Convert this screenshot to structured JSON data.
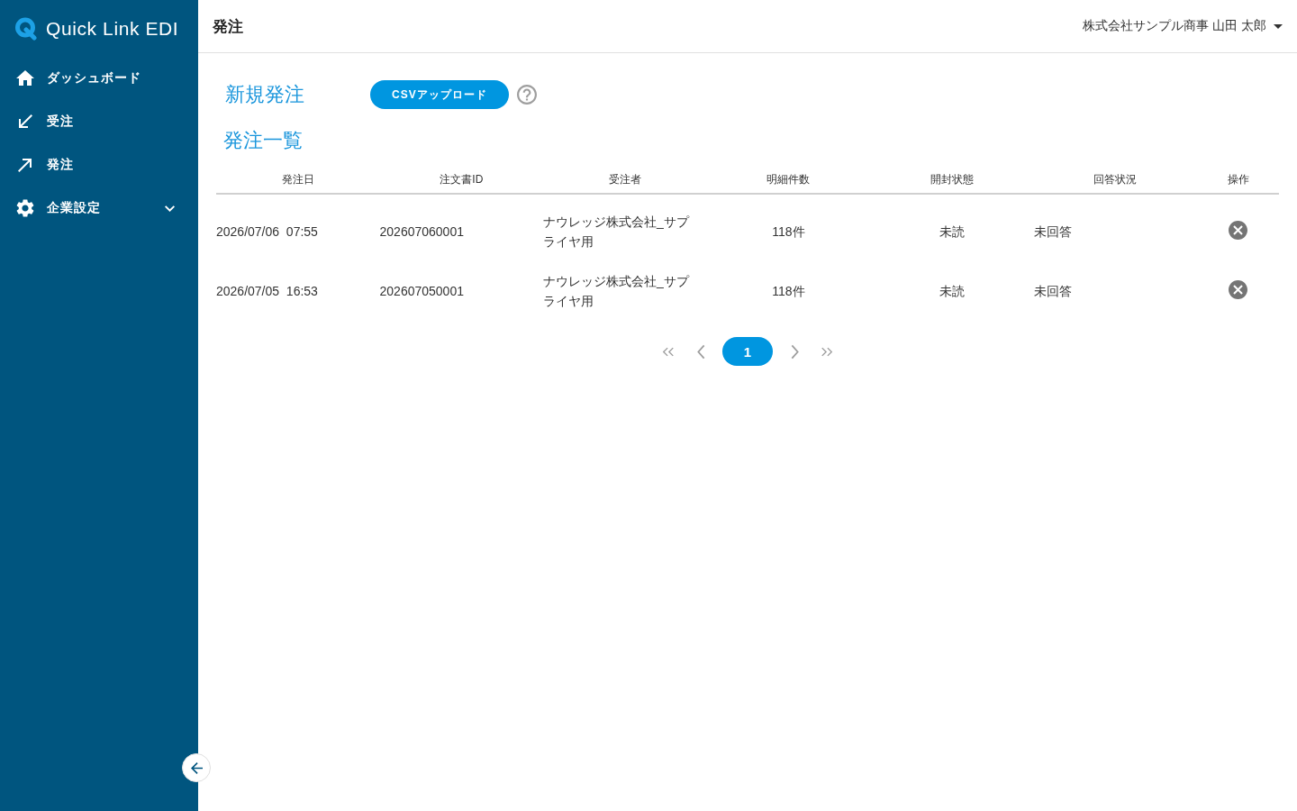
{
  "sidebar": {
    "logo": "Quick Link EDI",
    "items": [
      {
        "kind": "link",
        "label": "ダッシュボード"
      },
      {
        "kind": "link",
        "label": "受注"
      },
      {
        "kind": "link",
        "label": "発注"
      },
      {
        "kind": "group",
        "label": "企業設定",
        "expanded": false
      }
    ]
  },
  "header": {
    "title": "発注",
    "user": "株式会社サンプル商事 山田 太郎"
  },
  "new_order": {
    "heading": "新規発注",
    "upload_button": "CSVアップロード"
  },
  "order_list": {
    "heading": "発注一覧",
    "columns": [
      "発注日",
      "注文書ID",
      "受注者",
      "明細件数",
      "開封状態",
      "回答状況",
      "操作"
    ],
    "rows": [
      {
        "order_date": "2026/07/06  07:55",
        "order_id": "202607060001",
        "recipient": "ナウレッジ株式会社_サプライヤ用",
        "line_count": "118件",
        "open_status": "未読",
        "reply_status": "未回答"
      },
      {
        "order_date": "2026/07/05  16:53",
        "order_id": "202607050001",
        "recipient": "ナウレッジ株式会社_サプライヤ用",
        "line_count": "118件",
        "open_status": "未読",
        "reply_status": "未回答"
      }
    ]
  },
  "pagination": {
    "pages": [
      {
        "label": "1",
        "selected": true
      }
    ]
  }
}
